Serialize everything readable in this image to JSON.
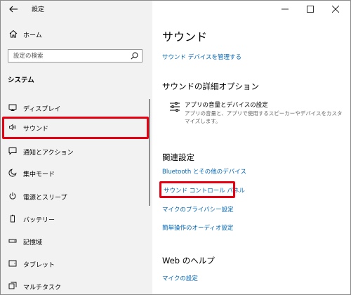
{
  "window": {
    "title": "設定"
  },
  "sidebar": {
    "home_label": "ホーム",
    "search_placeholder": "設定の検索",
    "section_heading": "システム",
    "items": [
      {
        "label": "ディスプレイ",
        "icon": "display-icon"
      },
      {
        "label": "サウンド",
        "icon": "speaker-icon",
        "selected": true
      },
      {
        "label": "通知とアクション",
        "icon": "notification-icon"
      },
      {
        "label": "集中モード",
        "icon": "moon-icon"
      },
      {
        "label": "電源とスリープ",
        "icon": "power-icon"
      },
      {
        "label": "バッテリー",
        "icon": "battery-icon"
      },
      {
        "label": "記憶域",
        "icon": "storage-icon"
      },
      {
        "label": "タブレット",
        "icon": "tablet-icon"
      },
      {
        "label": "マルチタスク",
        "icon": "multitask-icon"
      }
    ]
  },
  "main": {
    "title": "サウンド",
    "manage_devices_link": "サウンド デバイスを管理する",
    "advanced_heading": "サウンドの詳細オプション",
    "advanced_item": {
      "title": "アプリの音量とデバイスの設定",
      "description": "アプリの音量と、アプリで使用するスピーカーやデバイスをカスタマイズします。"
    },
    "related_heading": "関連設定",
    "related_links": [
      "Bluetooth とその他のデバイス",
      "サウンド コントロール パネル",
      "マイクのプライバシー設定",
      "簡単操作のオーディオ設定"
    ],
    "help_heading": "Web のヘルプ",
    "help_links": [
      "マイクの設定"
    ]
  },
  "colors": {
    "accent": "#0067b8",
    "highlight": "#e60012",
    "sidebar_bg": "#f2f2f2"
  }
}
